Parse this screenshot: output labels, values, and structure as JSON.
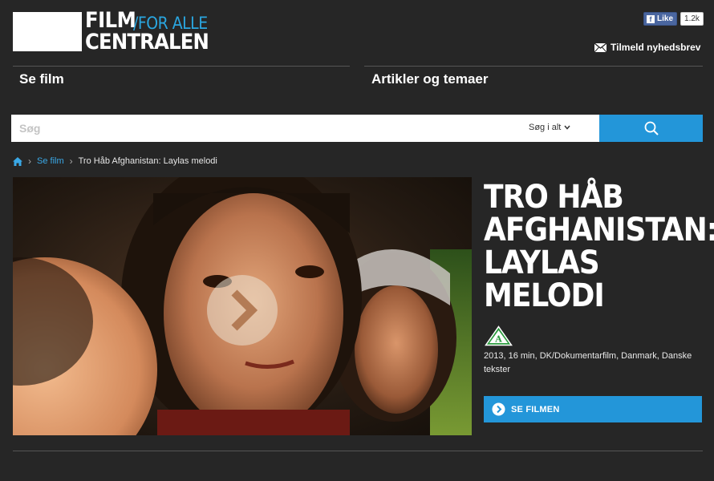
{
  "header": {
    "logo_film": "FILM",
    "logo_centralen": "CENTRALEN",
    "logo_tagline": "/FOR ALLE",
    "facebook": {
      "like_label": "Like",
      "count": "1.2k"
    },
    "newsletter_label": "Tilmeld nyhedsbrev"
  },
  "nav": {
    "left_label": "Se film",
    "right_label": "Artikler og temaer"
  },
  "search": {
    "placeholder": "Søg",
    "scope_label": "Søg i alt"
  },
  "breadcrumb": {
    "home_icon": "home-icon",
    "items": [
      "Se film",
      "Tro Håb Afghanistan: Laylas melodi"
    ]
  },
  "film": {
    "title": "TRO HÅB AFGHANISTAN: LAYLAS MELODI",
    "rating_label": "A",
    "meta": "2013, 16 min, DK/Dokumentarfilm, Danmark, Danske tekster",
    "cta_label": "SE FILMEN"
  },
  "colors": {
    "background": "#262626",
    "accent": "#2396d9",
    "rating_green": "#2b9a3e"
  }
}
